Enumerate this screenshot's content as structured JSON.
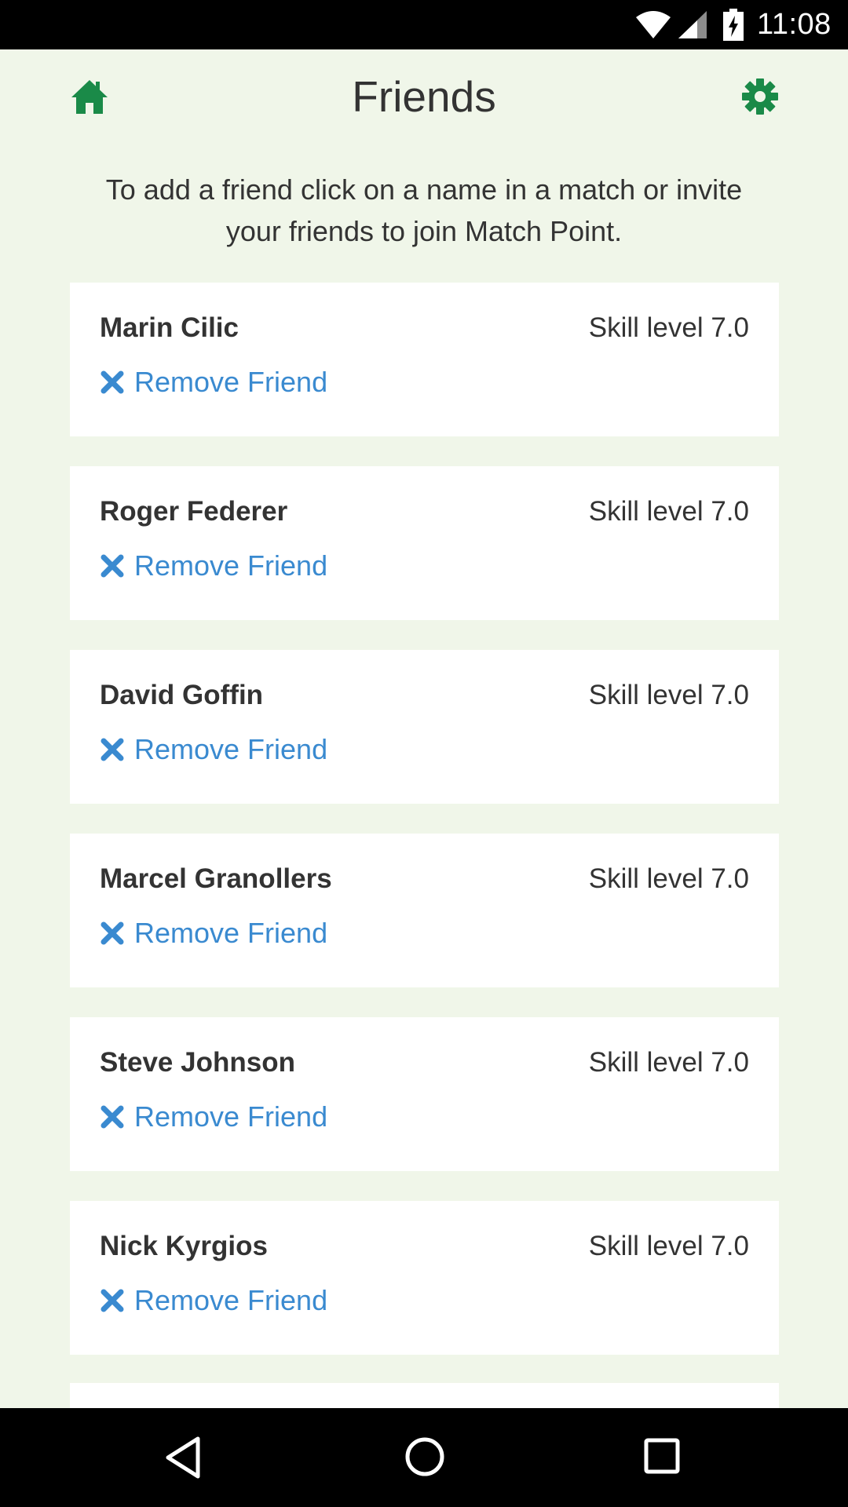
{
  "status_bar": {
    "time": "11:08",
    "icons": [
      "wifi-icon",
      "signal-icon",
      "battery-charging-icon"
    ]
  },
  "header": {
    "title": "Friends",
    "left_icon": "home-icon",
    "right_icon": "gear-icon",
    "accent_color": "#1a8a48"
  },
  "intro": {
    "text": "To add a friend click on a name in a match or invite your friends to join Match Point."
  },
  "friends": [
    {
      "name": "Marin Cilic",
      "skill": "Skill level 7.0",
      "remove_label": "Remove Friend"
    },
    {
      "name": "Roger Federer",
      "skill": "Skill level 7.0",
      "remove_label": "Remove Friend"
    },
    {
      "name": "David Goffin",
      "skill": "Skill level 7.0",
      "remove_label": "Remove Friend"
    },
    {
      "name": "Marcel Granollers",
      "skill": "Skill level 7.0",
      "remove_label": "Remove Friend"
    },
    {
      "name": "Steve Johnson",
      "skill": "Skill level 7.0",
      "remove_label": "Remove Friend"
    },
    {
      "name": "Nick Kyrgios",
      "skill": "Skill level 7.0",
      "remove_label": "Remove Friend"
    }
  ],
  "colors": {
    "background": "#f0f6e9",
    "card": "#ffffff",
    "link": "#3a8ad0",
    "text": "#333333"
  },
  "nav_bar": {
    "icons": [
      "back-icon",
      "home-circle-icon",
      "recents-icon"
    ]
  }
}
